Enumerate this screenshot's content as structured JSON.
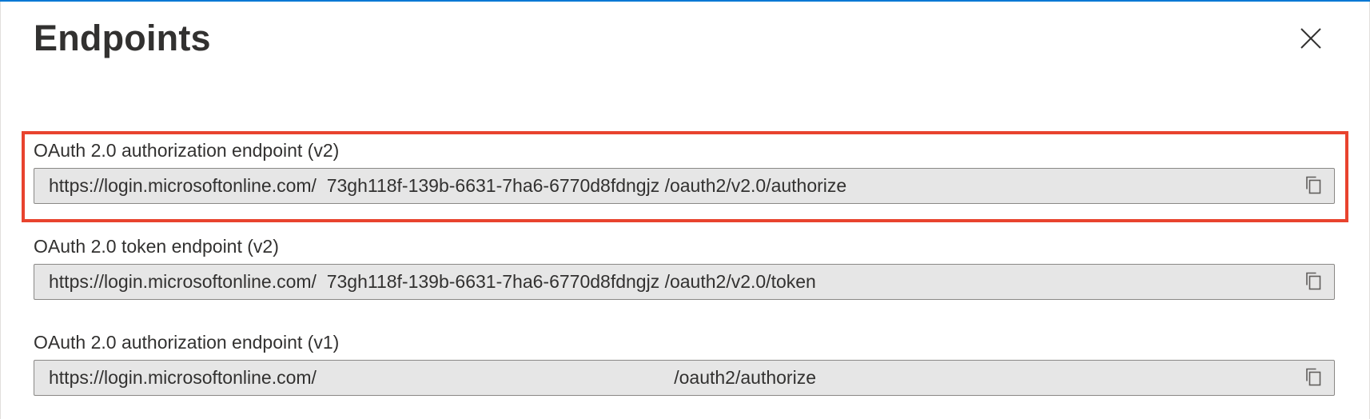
{
  "panel": {
    "title": "Endpoints"
  },
  "endpoints": [
    {
      "label": "OAuth 2.0 authorization endpoint (v2)",
      "value": "https://login.microsoftonline.com/  73gh118f-139b-6631-7ha6-6770d8fdngjz /oauth2/v2.0/authorize",
      "highlighted": true
    },
    {
      "label": "OAuth 2.0 token endpoint (v2)",
      "value": "https://login.microsoftonline.com/  73gh118f-139b-6631-7ha6-6770d8fdngjz /oauth2/v2.0/token",
      "highlighted": false
    },
    {
      "label": "OAuth 2.0 authorization endpoint (v1)",
      "value": "https://login.microsoftonline.com/                                                                      /oauth2/authorize",
      "highlighted": false
    }
  ],
  "icons": {
    "close": "close-icon",
    "copy": "copy-icon"
  },
  "colors": {
    "accent": "#0078d4",
    "highlight": "#e8432e",
    "field_background": "#e6e6e6",
    "field_border": "#8a8886",
    "text": "#323130"
  }
}
